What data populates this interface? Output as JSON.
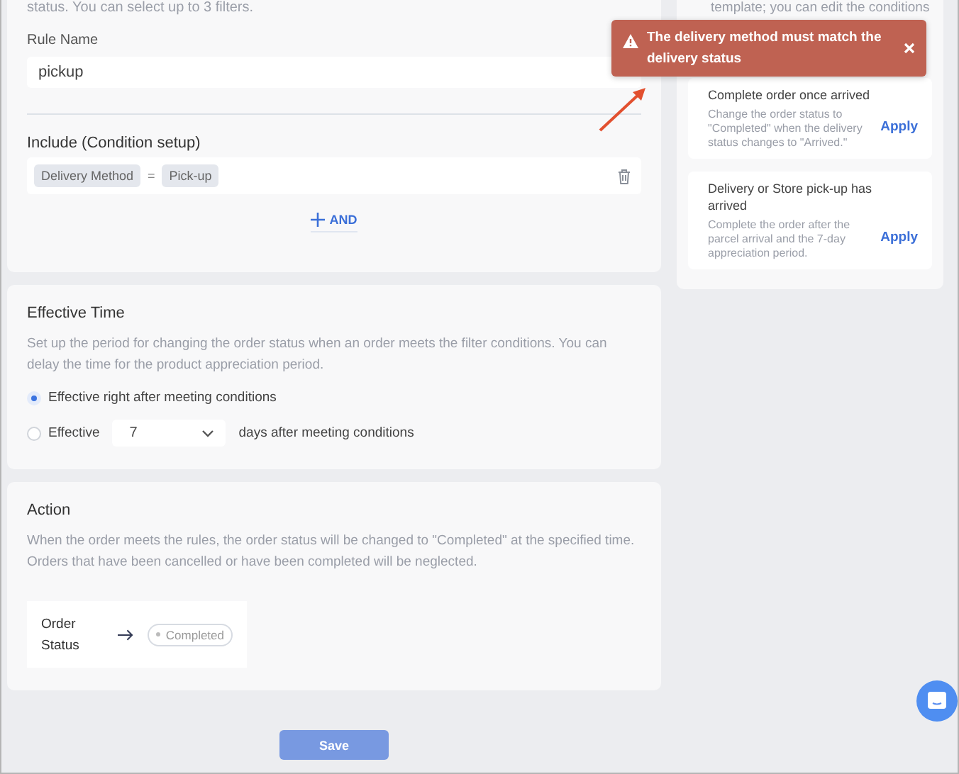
{
  "rule_card": {
    "intro": "status. You can select up to 3 filters.",
    "rule_name": {
      "label": "Rule Name",
      "value": "pickup"
    },
    "include": {
      "title": "Include (Condition setup)",
      "conditions": [
        {
          "field": "Delivery Method",
          "operator": "=",
          "value": "Pick-up"
        }
      ],
      "add_button": "AND"
    }
  },
  "effective_time": {
    "title": "Effective Time",
    "description": "Set up the period for changing the order status when an order meets the filter conditions. You can delay the time for the product appreciation period.",
    "options": [
      {
        "kind": "plain",
        "label": "Effective right after meeting conditions",
        "selected": true
      },
      {
        "kind": "select",
        "prefix": "Effective",
        "value": "7",
        "suffix": "days after meeting conditions",
        "selected": false
      }
    ]
  },
  "action": {
    "title": "Action",
    "description": "When the order meets the rules, the order status will be changed to \"Completed\" at the specified time. Orders that have been cancelled or have been completed will be neglected.",
    "status_label": "Order Status",
    "status_value": "Completed"
  },
  "save_button": "Save",
  "templates": {
    "intro": "template; you can edit the conditions",
    "items": [
      {
        "title": "Complete order once arrived",
        "description": "Change the order status to \"Completed\" when the delivery status changes to \"Arrived.\"",
        "action": "Apply"
      },
      {
        "title": "Delivery or Store pick-up has arrived",
        "description": "Complete the order after the parcel arrival and the 7-day appreciation period.",
        "action": "Apply"
      }
    ]
  },
  "toast": {
    "message": "The delivery method must match the delivery status"
  }
}
